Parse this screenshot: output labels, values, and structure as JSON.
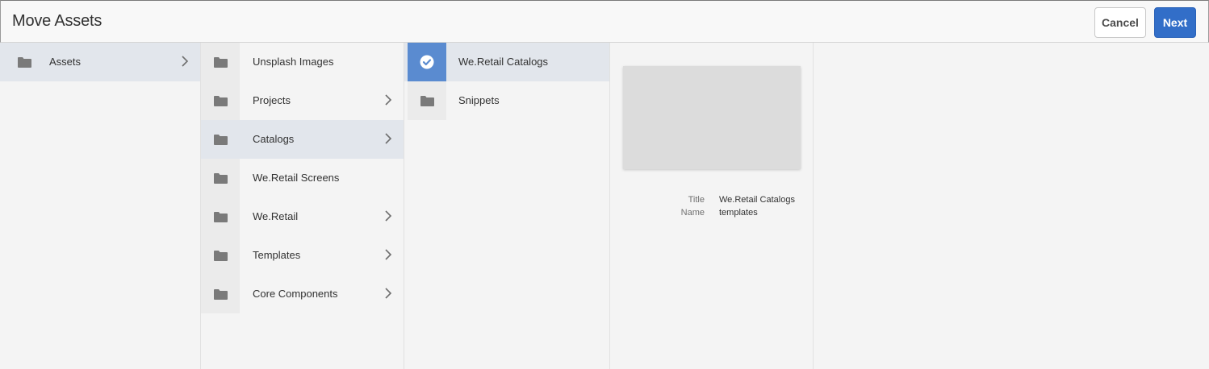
{
  "dialog": {
    "title": "Move Assets",
    "cancel_label": "Cancel",
    "next_label": "Next"
  },
  "columns": [
    {
      "items": [
        {
          "label": "Assets",
          "has_children": true,
          "active": true
        }
      ]
    },
    {
      "items": [
        {
          "label": "Unsplash Images",
          "has_children": false
        },
        {
          "label": "Projects",
          "has_children": true
        },
        {
          "label": "Catalogs",
          "has_children": true,
          "active": true
        },
        {
          "label": "We.Retail Screens",
          "has_children": false
        },
        {
          "label": "We.Retail",
          "has_children": true
        },
        {
          "label": "Templates",
          "has_children": true
        },
        {
          "label": "Core Components",
          "has_children": true
        }
      ]
    },
    {
      "items": [
        {
          "label": "We.Retail Catalogs",
          "selected": true
        },
        {
          "label": "Snippets",
          "selected": false
        }
      ]
    }
  ],
  "preview": {
    "title_key": "Title",
    "title_value": "We.Retail Catalogs",
    "name_key": "Name",
    "name_value": "templates"
  },
  "colors": {
    "accent": "#326ec8",
    "selected_thumb": "#5a8bd0",
    "active_row": "#e2e6ec"
  },
  "icons": {
    "folder": "folder-icon",
    "chevron": "chevron-right-icon",
    "check": "checkmark-icon"
  }
}
